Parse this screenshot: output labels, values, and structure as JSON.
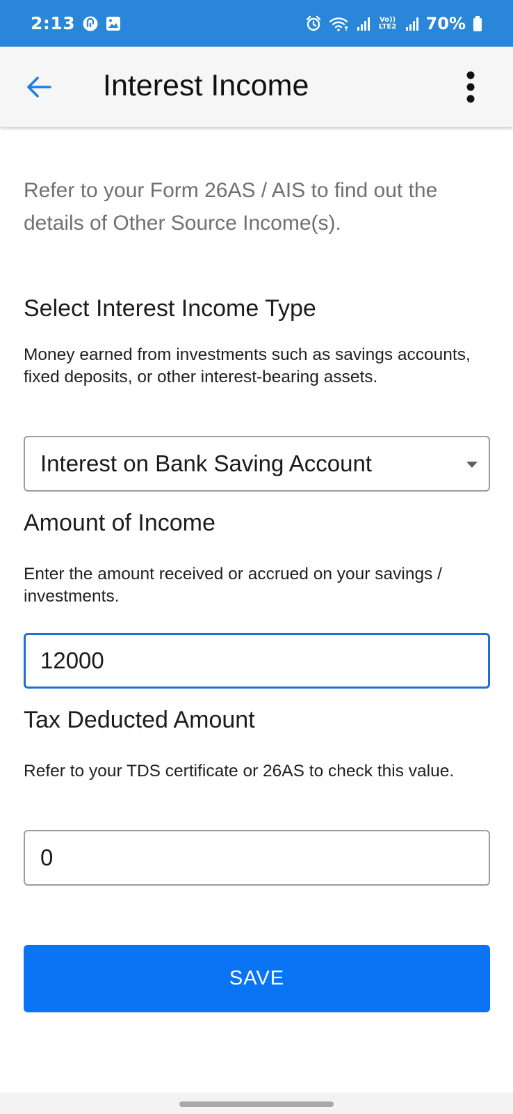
{
  "status_bar": {
    "time": "2:13",
    "battery": "70%",
    "network_label": "Vo)) LTE2"
  },
  "app_bar": {
    "title": "Interest Income"
  },
  "intro_text": "Refer to your Form 26AS / AIS to find out the details of Other Source Income(s).",
  "interest_type": {
    "title": "Select Interest Income Type",
    "description": "Money earned from investments such as savings accounts, fixed deposits, or other interest-bearing assets.",
    "selected": "Interest on Bank Saving Account"
  },
  "amount": {
    "title": "Amount of Income",
    "description": "Enter the amount received or accrued on your savings / investments.",
    "value": "12000"
  },
  "tax": {
    "title": "Tax Deducted Amount",
    "description": "Refer to your TDS certificate or 26AS to check this value.",
    "value": "0"
  },
  "save_label": "SAVE",
  "colors": {
    "status_bar": "#2a86d8",
    "accent": "#0a74f5",
    "focus_border": "#1f6fd1",
    "back_arrow": "#1f7fe0"
  }
}
